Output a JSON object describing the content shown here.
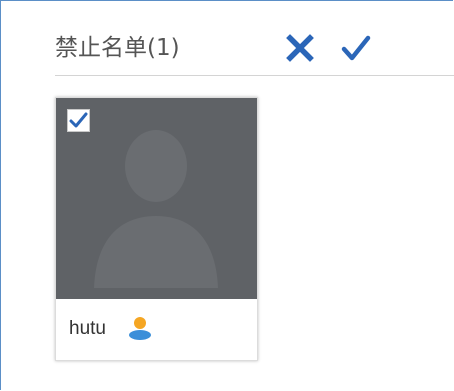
{
  "header": {
    "title": "禁止名单(1)",
    "cancel_icon": "close-icon",
    "confirm_icon": "check-icon"
  },
  "members": [
    {
      "username": "hutu",
      "selected": true,
      "avatar_icon": "person-placeholder-icon",
      "badge_icon": "user-icon"
    }
  ],
  "colors": {
    "accent": "#2b66b8",
    "avatar_bg": "#5f6266",
    "frame_border": "#5b8fc7",
    "user_icon_head": "#f5a623",
    "user_icon_body": "#3b8fd9"
  }
}
